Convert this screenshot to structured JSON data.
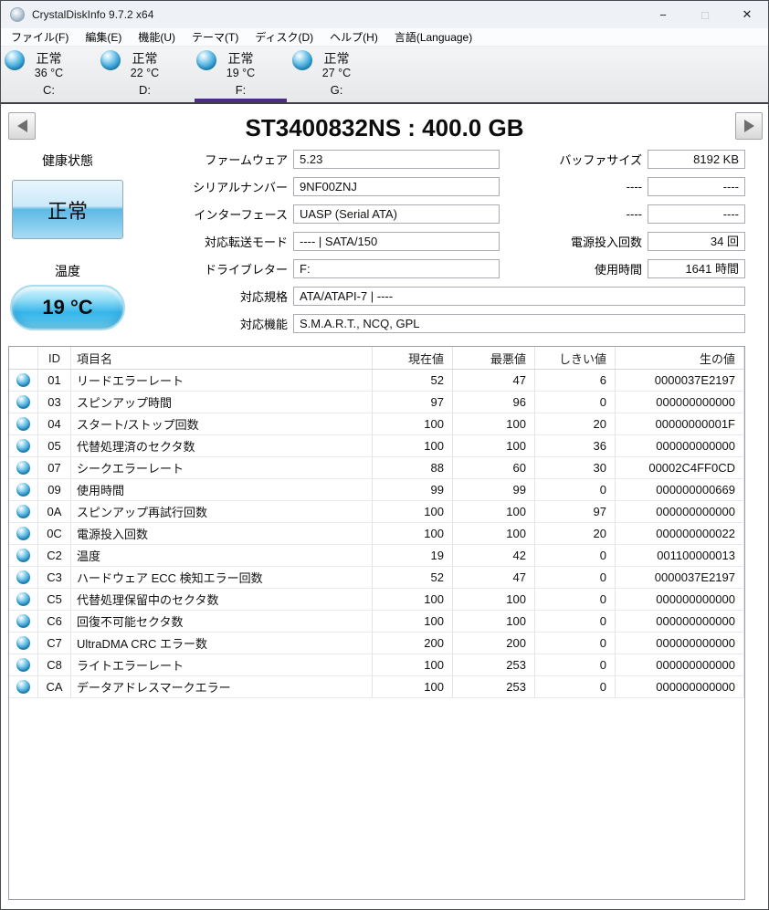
{
  "window": {
    "title": "CrystalDiskInfo 9.7.2 x64",
    "controls": {
      "minimize": "−",
      "maximize": "□",
      "close": "✕"
    }
  },
  "menu": {
    "items": [
      "ファイル(F)",
      "編集(E)",
      "機能(U)",
      "テーマ(T)",
      "ディスク(D)",
      "ヘルプ(H)",
      "言語(Language)"
    ]
  },
  "tabs": [
    {
      "status": "正常",
      "temperature": "36 °C",
      "drive": "C:",
      "selected": false
    },
    {
      "status": "正常",
      "temperature": "22 °C",
      "drive": "D:",
      "selected": false
    },
    {
      "status": "正常",
      "temperature": "19 °C",
      "drive": "F:",
      "selected": true
    },
    {
      "status": "正常",
      "temperature": "27 °C",
      "drive": "G:",
      "selected": false
    }
  ],
  "drive_panel": {
    "title": "ST3400832NS : 400.0 GB"
  },
  "health": {
    "label": "健康状態",
    "status": "正常"
  },
  "temperature": {
    "label": "温度",
    "value": "19 °C"
  },
  "info_left": [
    {
      "label": "ファームウェア",
      "value": "5.23"
    },
    {
      "label": "シリアルナンバー",
      "value": "9NF00ZNJ"
    },
    {
      "label": "インターフェース",
      "value": "UASP (Serial ATA)"
    },
    {
      "label": "対応転送モード",
      "value": "---- | SATA/150"
    },
    {
      "label": "ドライブレター",
      "value": "F:"
    }
  ],
  "info_right": [
    {
      "label": "バッファサイズ",
      "value": "8192 KB"
    },
    {
      "label": "----",
      "value": "----"
    },
    {
      "label": "----",
      "value": "----"
    },
    {
      "label": "電源投入回数",
      "value": "34 回"
    },
    {
      "label": "使用時間",
      "value": "1641 時間"
    }
  ],
  "info_wide": [
    {
      "label": "対応規格",
      "value": "ATA/ATAPI-7 | ----"
    },
    {
      "label": "対応機能",
      "value": "S.M.A.R.T., NCQ, GPL"
    }
  ],
  "smart_table": {
    "headers": [
      "ID",
      "項目名",
      "現在値",
      "最悪値",
      "しきい値",
      "生の値"
    ],
    "rows": [
      {
        "id": "01",
        "name": "リードエラーレート",
        "current": "52",
        "worst": "47",
        "threshold": "6",
        "raw": "0000037E2197"
      },
      {
        "id": "03",
        "name": "スピンアップ時間",
        "current": "97",
        "worst": "96",
        "threshold": "0",
        "raw": "000000000000"
      },
      {
        "id": "04",
        "name": "スタート/ストップ回数",
        "current": "100",
        "worst": "100",
        "threshold": "20",
        "raw": "00000000001F"
      },
      {
        "id": "05",
        "name": "代替処理済のセクタ数",
        "current": "100",
        "worst": "100",
        "threshold": "36",
        "raw": "000000000000"
      },
      {
        "id": "07",
        "name": "シークエラーレート",
        "current": "88",
        "worst": "60",
        "threshold": "30",
        "raw": "00002C4FF0CD"
      },
      {
        "id": "09",
        "name": "使用時間",
        "current": "99",
        "worst": "99",
        "threshold": "0",
        "raw": "000000000669"
      },
      {
        "id": "0A",
        "name": "スピンアップ再試行回数",
        "current": "100",
        "worst": "100",
        "threshold": "97",
        "raw": "000000000000"
      },
      {
        "id": "0C",
        "name": "電源投入回数",
        "current": "100",
        "worst": "100",
        "threshold": "20",
        "raw": "000000000022"
      },
      {
        "id": "C2",
        "name": "温度",
        "current": "19",
        "worst": "42",
        "threshold": "0",
        "raw": "001100000013"
      },
      {
        "id": "C3",
        "name": "ハードウェア ECC 検知エラー回数",
        "current": "52",
        "worst": "47",
        "threshold": "0",
        "raw": "0000037E2197"
      },
      {
        "id": "C5",
        "name": "代替処理保留中のセクタ数",
        "current": "100",
        "worst": "100",
        "threshold": "0",
        "raw": "000000000000"
      },
      {
        "id": "C6",
        "name": "回復不可能セクタ数",
        "current": "100",
        "worst": "100",
        "threshold": "0",
        "raw": "000000000000"
      },
      {
        "id": "C7",
        "name": "UltraDMA CRC エラー数",
        "current": "200",
        "worst": "200",
        "threshold": "0",
        "raw": "000000000000"
      },
      {
        "id": "C8",
        "name": "ライトエラーレート",
        "current": "100",
        "worst": "253",
        "threshold": "0",
        "raw": "000000000000"
      },
      {
        "id": "CA",
        "name": "データアドレスマークエラー",
        "current": "100",
        "worst": "253",
        "threshold": "0",
        "raw": "000000000000"
      }
    ]
  },
  "colors": {
    "selected_tab_underline": "#4b2e83",
    "status_good_orb": "#1987bd",
    "health_button_blue": "#5fb9e6",
    "temp_pill_blue": "#36b5ea",
    "titlebar_bg": "#eef1f6"
  }
}
